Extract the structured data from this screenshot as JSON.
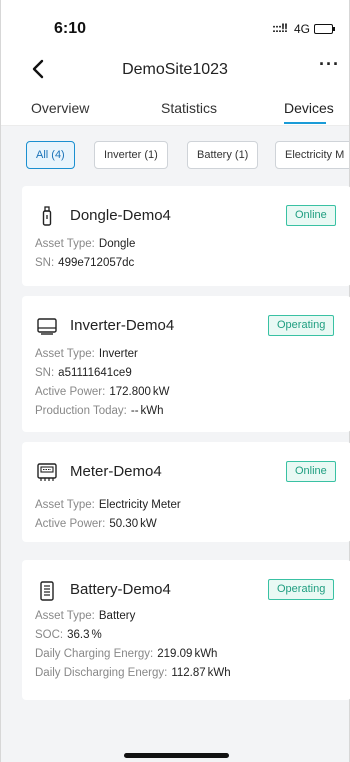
{
  "status_bar": {
    "time": "6:10",
    "signal": ":::!!",
    "network": "4G"
  },
  "nav": {
    "title": "DemoSite1023"
  },
  "tabs": [
    {
      "label": "Overview"
    },
    {
      "label": "Statistics"
    },
    {
      "label": "Devices"
    }
  ],
  "filters": [
    {
      "label": "All (4)"
    },
    {
      "label": "Inverter (1)"
    },
    {
      "label": "Battery (1)"
    },
    {
      "label": "Electricity M"
    }
  ],
  "devices": [
    {
      "name": "Dongle-Demo4",
      "status": "Online",
      "icon": "dongle-icon",
      "rows": [
        {
          "label": "Asset Type:",
          "value": "Dongle",
          "unit": ""
        },
        {
          "label": "SN:",
          "value": "499e712057dc",
          "unit": ""
        }
      ]
    },
    {
      "name": "Inverter-Demo4",
      "status": "Operating",
      "icon": "inverter-icon",
      "rows": [
        {
          "label": "Asset Type:",
          "value": "Inverter",
          "unit": ""
        },
        {
          "label": "SN:",
          "value": "a51111641ce9",
          "unit": ""
        },
        {
          "label": "Active Power:",
          "value": "172.800",
          "unit": "kW"
        },
        {
          "label": "Production Today:",
          "value": "--",
          "unit": "kWh"
        }
      ]
    },
    {
      "name": "Meter-Demo4",
      "status": "Online",
      "icon": "meter-icon",
      "rows": [
        {
          "label": "Asset Type:",
          "value": "Electricity Meter",
          "unit": ""
        },
        {
          "label": "Active Power:",
          "value": "50.30",
          "unit": "kW"
        }
      ]
    },
    {
      "name": "Battery-Demo4",
      "status": "Operating",
      "icon": "battery-icon",
      "rows": [
        {
          "label": "Asset Type:",
          "value": "Battery",
          "unit": ""
        },
        {
          "label": "SOC:",
          "value": "36.3",
          "unit": "%"
        },
        {
          "label": "Daily Charging Energy:",
          "value": "219.09",
          "unit": "kWh"
        },
        {
          "label": "Daily Discharging Energy:",
          "value": "112.87",
          "unit": "kWh"
        }
      ]
    }
  ],
  "colors": {
    "accent": "#1a9bd7",
    "status_border": "#39c1a3",
    "status_text": "#1f9e80"
  }
}
